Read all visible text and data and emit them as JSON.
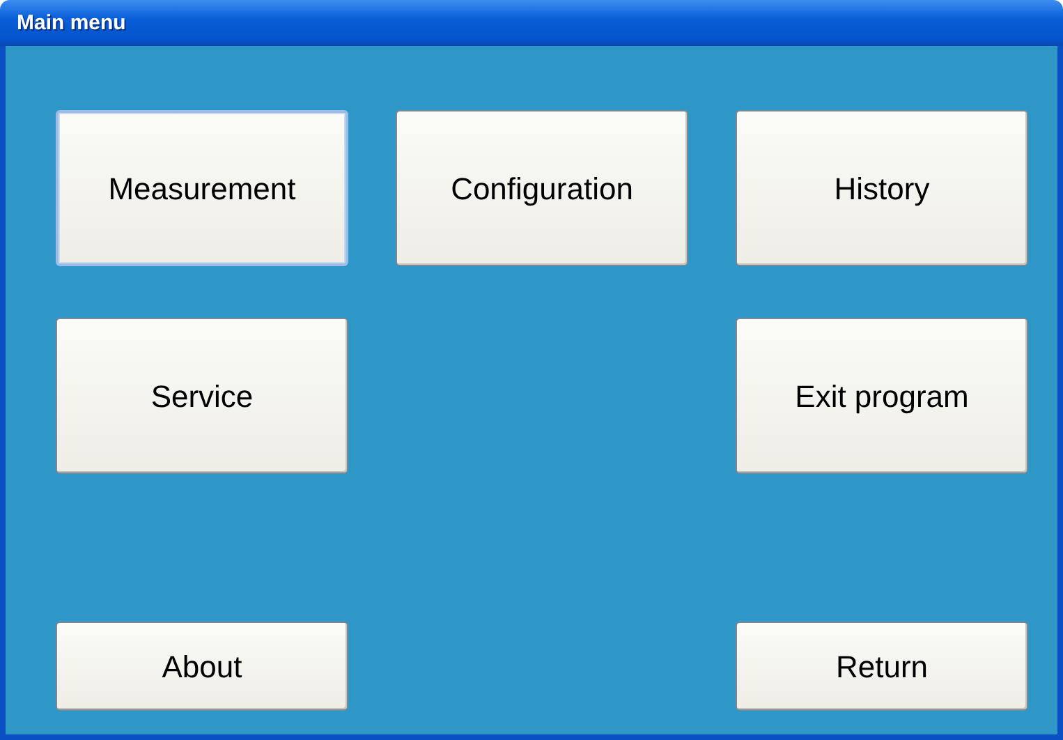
{
  "window": {
    "title": "Main menu"
  },
  "rows": [
    {
      "kind": "tall",
      "cells": [
        {
          "kind": "button",
          "label": "Measurement",
          "selected": true
        },
        {
          "kind": "button",
          "label": "Configuration",
          "selected": false
        },
        {
          "kind": "button",
          "label": "History",
          "selected": false
        }
      ]
    },
    {
      "kind": "tall",
      "cells": [
        {
          "kind": "button",
          "label": "Service",
          "selected": false
        },
        {
          "kind": "empty"
        },
        {
          "kind": "button",
          "label": "Exit program",
          "selected": false
        }
      ]
    },
    {
      "kind": "short",
      "cells": [
        {
          "kind": "button",
          "label": "About",
          "selected": false
        },
        {
          "kind": "empty"
        },
        {
          "kind": "button",
          "label": "Return",
          "selected": false
        }
      ]
    }
  ]
}
